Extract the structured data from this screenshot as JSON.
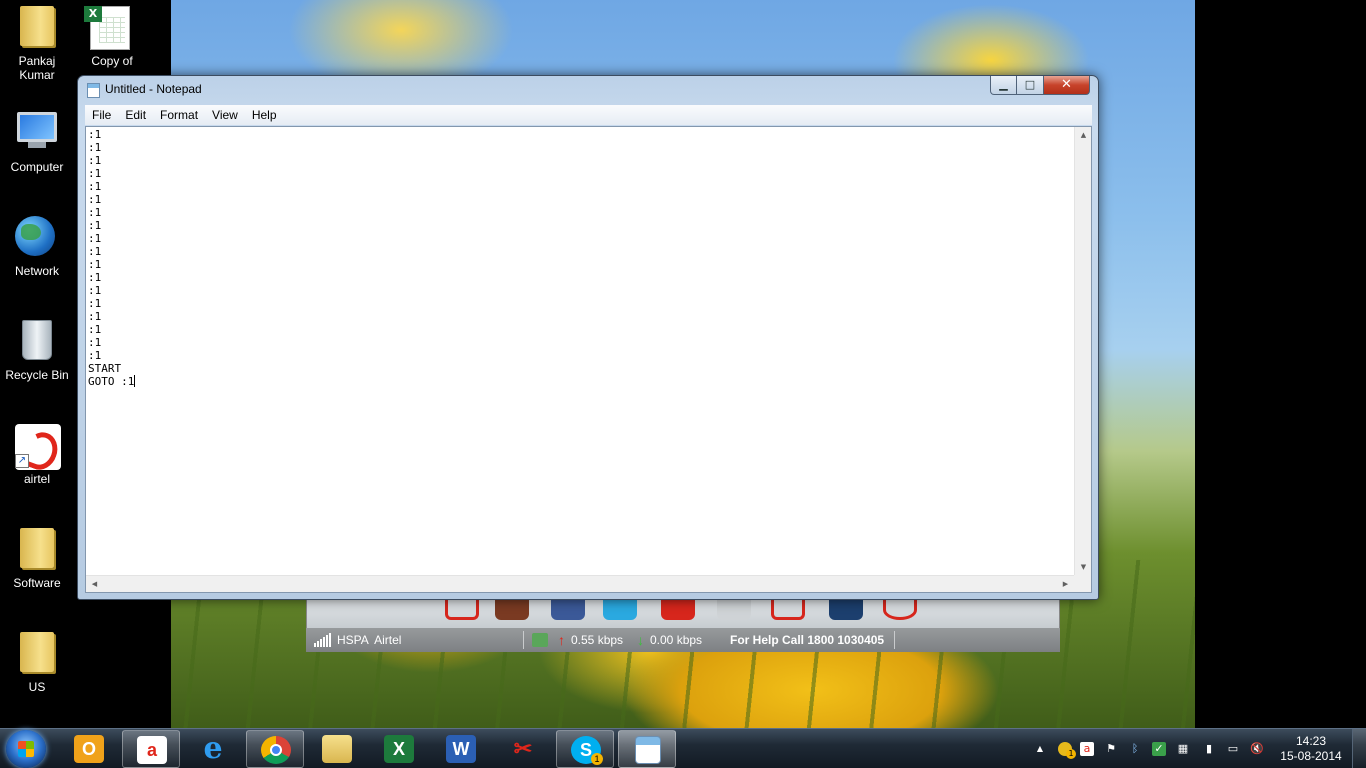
{
  "desktop": {
    "icons": [
      {
        "label": "Pankaj\nKumar",
        "icon": "user-folder-icon"
      },
      {
        "label": "Copy of",
        "icon": "excel-file-icon"
      },
      {
        "label": "Computer",
        "icon": "computer-icon"
      },
      {
        "label": "Network",
        "icon": "network-icon"
      },
      {
        "label": "Recycle Bin",
        "icon": "recycle-bin-icon"
      },
      {
        "label": "airtel",
        "icon": "airtel-icon"
      },
      {
        "label": "Software",
        "icon": "folder-icon"
      },
      {
        "label": "US",
        "icon": "folder-icon"
      }
    ]
  },
  "notepad": {
    "title": "Untitled - Notepad",
    "menu": [
      "File",
      "Edit",
      "Format",
      "View",
      "Help"
    ],
    "controls": {
      "minimize": "minimize-icon",
      "maximize": "maximize-icon",
      "close": "close-icon"
    },
    "content": ":1\n:1\n:1\n:1\n:1\n:1\n:1\n:1\n:1\n:1\n:1\n:1\n:1\n:1\n:1\n:1\n:1\n:1\nSTART\nGOTO :1"
  },
  "airtel_dock": {
    "network": "HSPA  Airtel",
    "upload": "0.55 kbps",
    "download": "0.00 kbps",
    "help": "For Help Call 1800 1030405",
    "colors": {
      "accent": "#e0261b"
    }
  },
  "taskbar": {
    "apps": [
      "outlook-icon",
      "airtel-icon",
      "internet-explorer-icon",
      "chrome-icon",
      "file-explorer-icon",
      "excel-icon",
      "word-icon",
      "snipping-tool-icon",
      "skype-icon",
      "notepad-icon"
    ],
    "skype_badge": "1",
    "tray_badge": "1",
    "clock": {
      "time": "14:23",
      "date": "15-08-2014"
    }
  }
}
